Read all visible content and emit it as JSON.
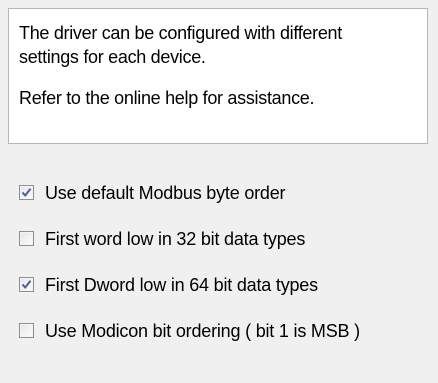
{
  "info": {
    "line1": "The driver can be configured with different",
    "line2": "settings for each device.",
    "line3": "Refer to the online help for assistance."
  },
  "options": [
    {
      "label": "Use default Modbus byte order",
      "checked": true
    },
    {
      "label": "First word low in 32 bit data types",
      "checked": false
    },
    {
      "label": "First Dword low in 64 bit data types",
      "checked": true
    },
    {
      "label": "Use Modicon bit ordering ( bit 1 is MSB )",
      "checked": false
    }
  ],
  "colors": {
    "checkmark": "#4a5f9c",
    "background": "#f0f0f0",
    "info_background": "#ffffff"
  }
}
